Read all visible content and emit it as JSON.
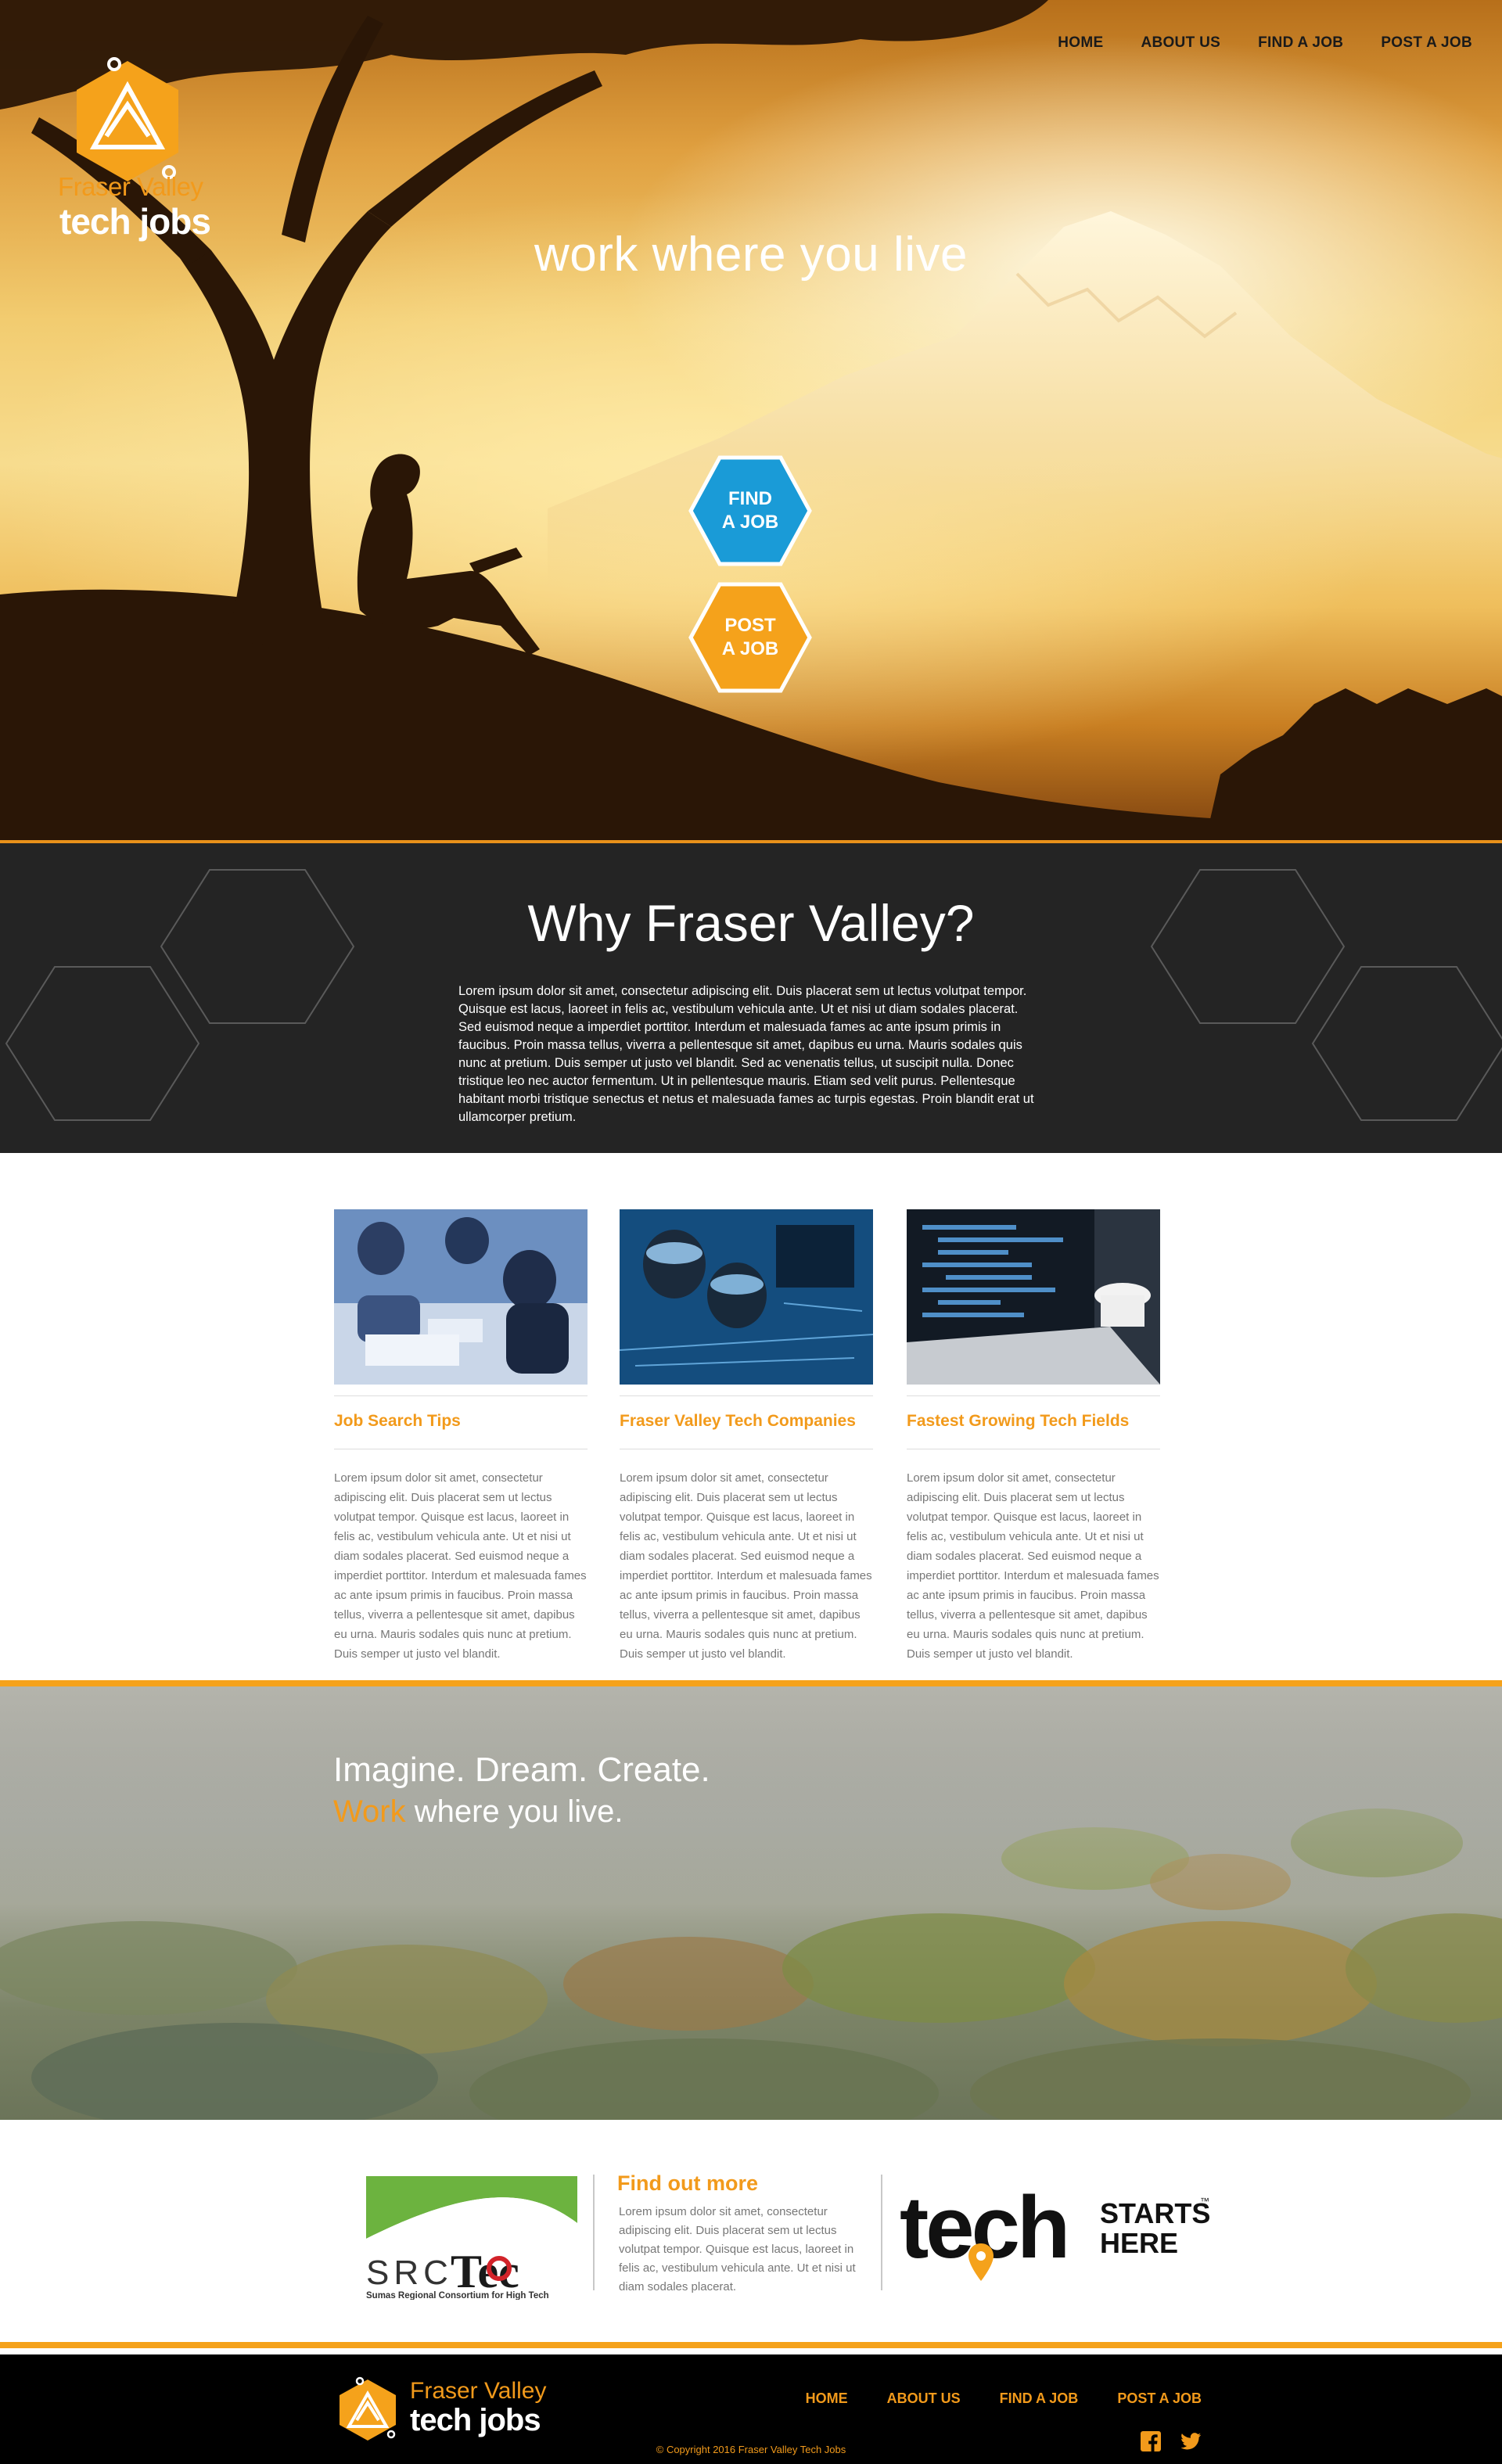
{
  "nav": {
    "items": [
      {
        "label": "HOME"
      },
      {
        "label": "ABOUT US"
      },
      {
        "label": "FIND A JOB"
      },
      {
        "label": "POST A JOB"
      }
    ]
  },
  "brand": {
    "line1": "Fraser Valley",
    "line2": "tech jobs"
  },
  "hero": {
    "tagline": "work where you live",
    "find_button": {
      "line1": "FIND",
      "line2": "A JOB",
      "color": "#1a9bd7"
    },
    "post_button": {
      "line1": "POST",
      "line2": "A JOB",
      "color": "#f5a21b"
    }
  },
  "why": {
    "title": "Why Fraser Valley?",
    "body": "Lorem ipsum dolor sit amet, consectetur adipiscing elit. Duis placerat sem ut lectus volutpat tempor. Quisque est lacus, laoreet in felis ac, vestibulum vehicula ante. Ut et nisi ut diam sodales placerat. Sed euismod neque a imperdiet porttitor. Interdum et malesuada fames ac ante ipsum primis in faucibus. Proin massa tellus, viverra a pellentesque sit amet, dapibus eu urna. Mauris sodales quis nunc at pretium. Duis semper ut justo vel blandit. Sed ac venenatis tellus, ut suscipit nulla. Donec tristique leo nec auctor fermentum. Ut in pellentesque mauris. Etiam sed velit purus. Pellentesque habitant morbi tristique senectus et netus et malesuada fames ac turpis egestas. Proin blandit erat ut ullamcorper pretium."
  },
  "cards": [
    {
      "title": "Job Search Tips",
      "body": "Lorem ipsum dolor sit amet, consectetur adipiscing elit. Duis placerat sem ut lectus volutpat tempor. Quisque est lacus, laoreet in felis ac, vestibulum vehicula ante. Ut et nisi ut diam sodales placerat. Sed euismod neque a imperdiet porttitor. Interdum et malesuada fames ac ante ipsum primis in faucibus. Proin massa tellus, viverra a pellentesque sit amet, dapibus eu urna. Mauris sodales quis nunc at pretium. Duis semper ut justo vel blandit."
    },
    {
      "title": "Fraser Valley Tech Companies",
      "body": "Lorem ipsum dolor sit amet, consectetur adipiscing elit. Duis placerat sem ut lectus volutpat tempor. Quisque est lacus, laoreet in felis ac, vestibulum vehicula ante. Ut et nisi ut diam sodales placerat. Sed euismod neque a imperdiet porttitor. Interdum et malesuada fames ac ante ipsum primis in faucibus. Proin massa tellus, viverra a pellentesque sit amet, dapibus eu urna. Mauris sodales quis nunc at pretium. Duis semper ut justo vel blandit."
    },
    {
      "title": "Fastest Growing Tech Fields",
      "body": "Lorem ipsum dolor sit amet, consectetur adipiscing elit. Duis placerat sem ut lectus volutpat tempor. Quisque est lacus, laoreet in felis ac, vestibulum vehicula ante. Ut et nisi ut diam sodales placerat. Sed euismod neque a imperdiet porttitor. Interdum et malesuada fames ac ante ipsum primis in faucibus. Proin massa tellus, viverra a pellentesque sit amet, dapibus eu urna. Mauris sodales quis nunc at pretium. Duis semper ut justo vel blandit."
    }
  ],
  "imagine": {
    "line1": "Imagine. Dream. Create.",
    "highlight": "Work",
    "line2_rest": " where you live."
  },
  "partners": {
    "srctec_logo": {
      "wordmark": "SRC",
      "mark": "Tec",
      "caption": "Sumas Regional Consortium for High Tech"
    },
    "find_more_title": "Find out more",
    "find_more_body": "Lorem ipsum dolor sit amet, consectetur adipiscing elit. Duis placerat sem ut lectus volutpat tempor. Quisque est lacus, laoreet in felis ac, vestibulum vehicula ante. Ut et nisi ut diam sodales placerat.",
    "tech_starts_logo": {
      "word": "tech",
      "tagline_1": "STARTS",
      "tagline_2": "HERE",
      "tm": "™"
    }
  },
  "footer": {
    "nav": [
      {
        "label": "HOME"
      },
      {
        "label": "ABOUT US"
      },
      {
        "label": "FIND A JOB"
      },
      {
        "label": "POST A JOB"
      }
    ],
    "social": [
      {
        "icon": "facebook-icon"
      },
      {
        "icon": "twitter-icon"
      }
    ],
    "copyright": "© Copyright 2016 Fraser Valley Tech Jobs"
  },
  "colors": {
    "accent_orange": "#f29a1b",
    "accent_blue": "#1a9bd7",
    "dark_band": "#242424",
    "footer_bg": "#000000"
  }
}
